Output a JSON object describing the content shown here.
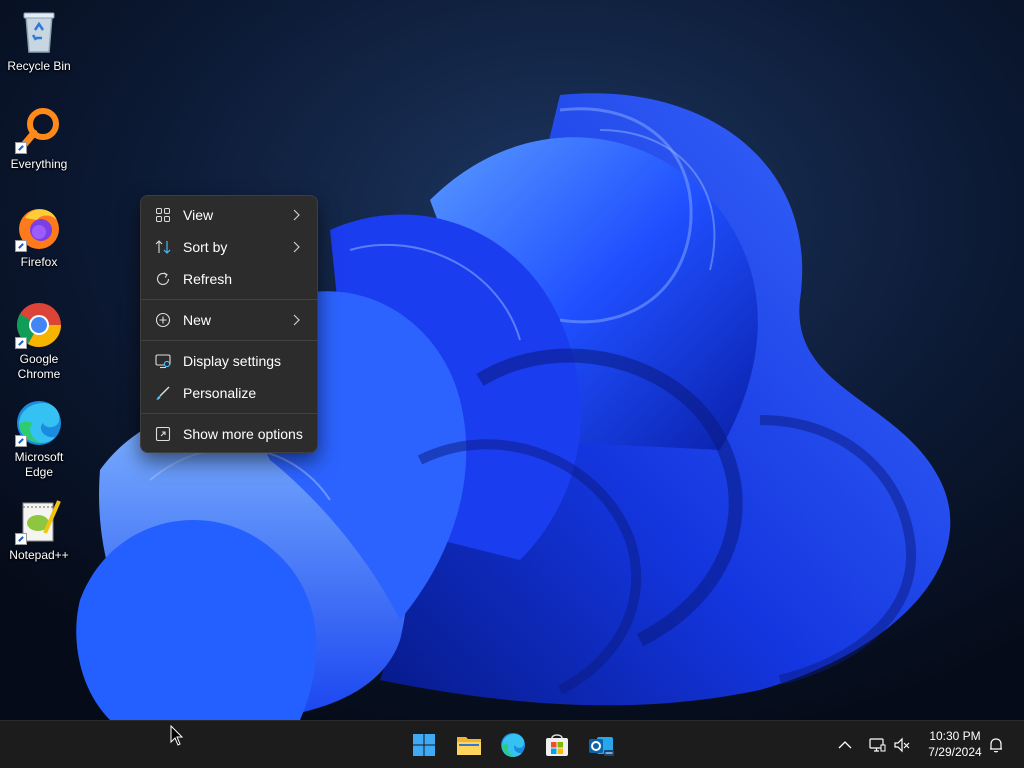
{
  "desktop": {
    "icons": [
      {
        "label": "Recycle Bin",
        "icon": "recycle-bin-icon"
      },
      {
        "label": "Everything",
        "icon": "everything-icon"
      },
      {
        "label": "Firefox",
        "icon": "firefox-icon"
      },
      {
        "label": "Google Chrome",
        "icon": "chrome-icon"
      },
      {
        "label": "Microsoft Edge",
        "icon": "edge-icon"
      },
      {
        "label": "Notepad++",
        "icon": "notepadpp-icon"
      }
    ]
  },
  "context_menu": {
    "items": [
      {
        "label": "View",
        "icon": "view-grid-icon",
        "submenu": true
      },
      {
        "label": "Sort by",
        "icon": "sort-icon",
        "submenu": true
      },
      {
        "label": "Refresh",
        "icon": "refresh-icon",
        "submenu": false
      },
      {
        "label": "New",
        "icon": "new-plus-icon",
        "submenu": true
      },
      {
        "label": "Display settings",
        "icon": "display-settings-icon",
        "submenu": false
      },
      {
        "label": "Personalize",
        "icon": "brush-icon",
        "submenu": false
      },
      {
        "label": "Show more options",
        "icon": "more-options-icon",
        "submenu": false
      }
    ]
  },
  "taskbar": {
    "apps": [
      "start-icon",
      "file-explorer-icon",
      "edge-icon",
      "store-icon",
      "outlook-icon"
    ],
    "tray": [
      "chevron-up-icon",
      "network-icon",
      "volume-muted-icon",
      "notification-bell-icon"
    ],
    "time": "10:30 PM",
    "date": "7/29/2024"
  },
  "colors": {
    "desktop_bg": "#0a1428",
    "bloom_blue": "#1f56ff",
    "menu_bg": "#2c2c2c",
    "taskbar_bg": "#1c1c1c",
    "accent": "#4cc2ff"
  }
}
